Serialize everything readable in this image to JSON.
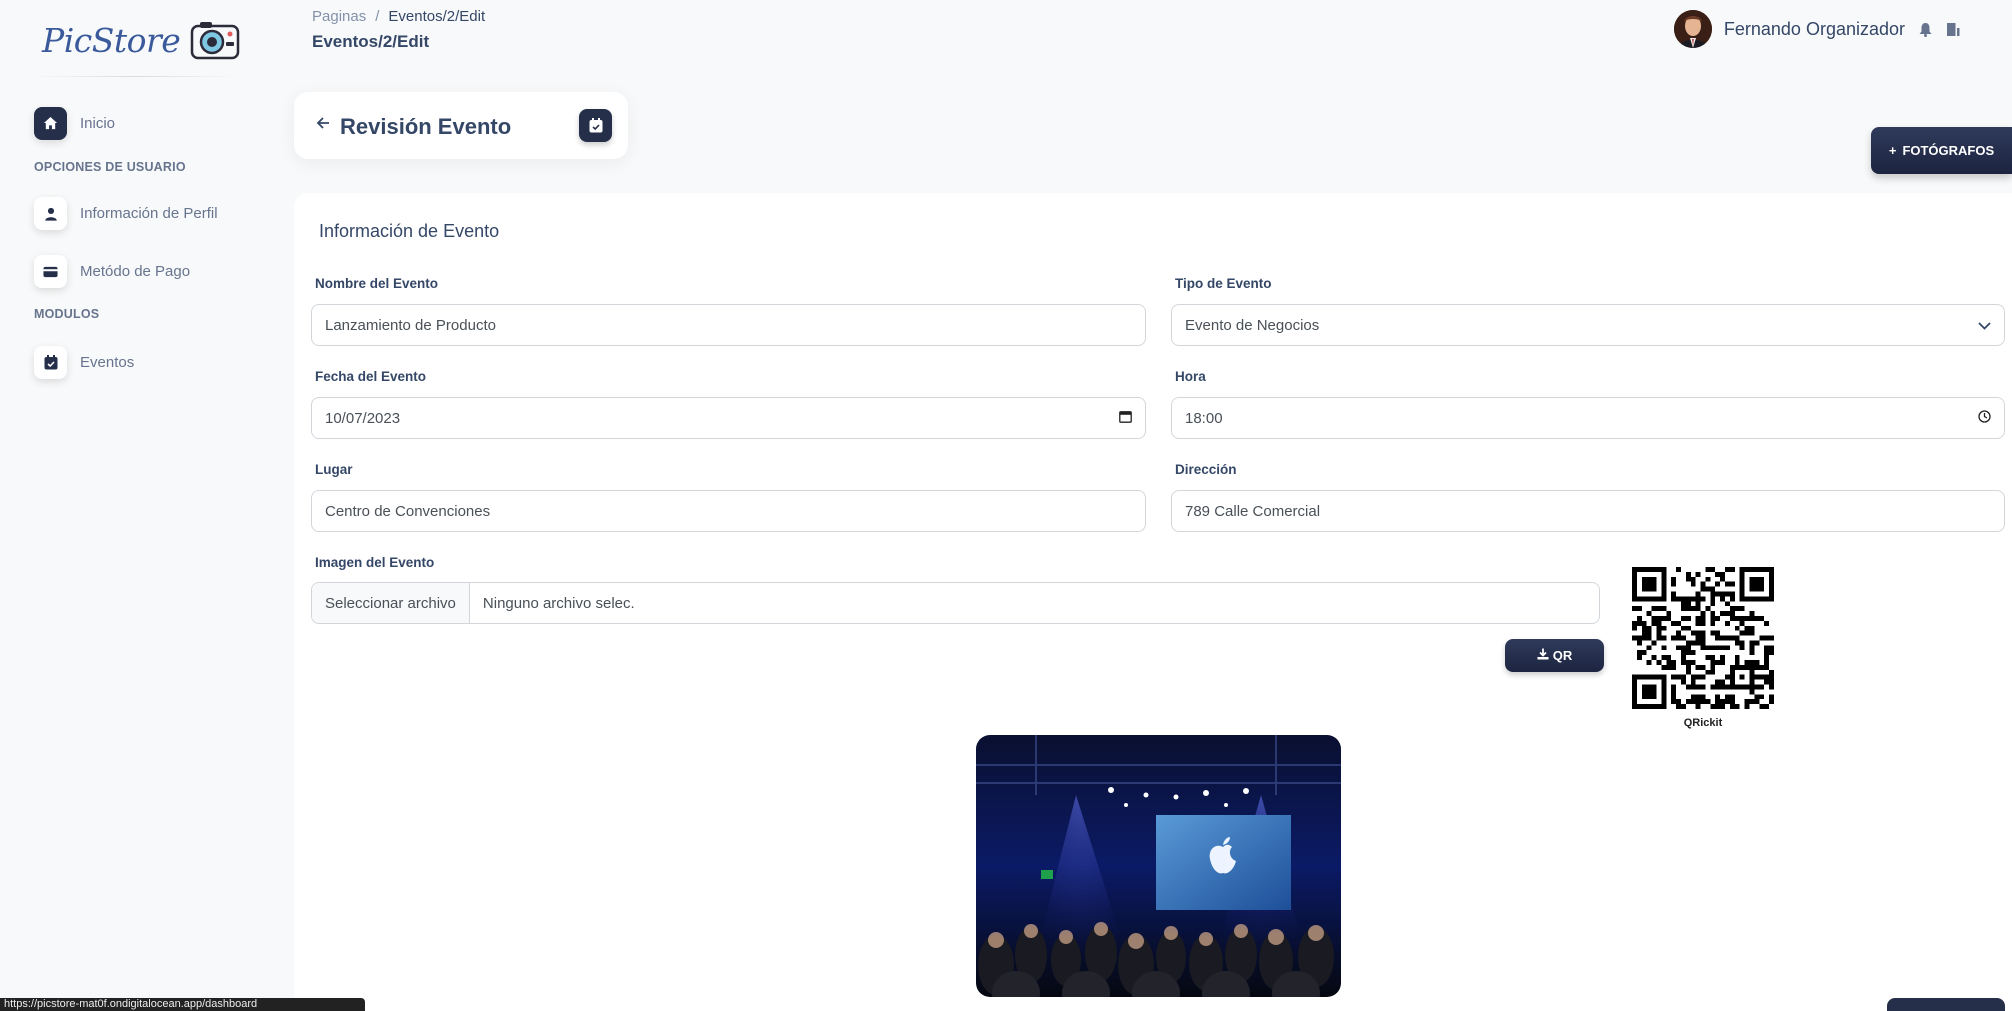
{
  "brand": {
    "name": "PicStore"
  },
  "sidebar": {
    "items": [
      {
        "label": "Inicio",
        "icon": "home-icon"
      },
      {
        "label": "Información de Perfil",
        "icon": "user-icon"
      },
      {
        "label": "Metódo de Pago",
        "icon": "credit-card-icon"
      },
      {
        "label": "Eventos",
        "icon": "calendar-check-icon"
      }
    ],
    "sections": [
      "OPCIONES DE USUARIO",
      "MODULOS"
    ]
  },
  "breadcrumb": {
    "root": "Paginas",
    "separator": "/",
    "current": "Eventos/2/Edit"
  },
  "header": {
    "title": "Eventos/2/Edit",
    "user_name": "Fernando Organizador"
  },
  "revision": {
    "title": "Revisión Evento"
  },
  "actions": {
    "photographers": "FOTÓGRAFOS",
    "qr": "QR"
  },
  "form": {
    "section_title": "Información de Evento",
    "name_label": "Nombre del Evento",
    "name_value": "Lanzamiento de Producto",
    "type_label": "Tipo de Evento",
    "type_value": "Evento de Negocios",
    "date_label": "Fecha del Evento",
    "date_value": "10/07/2023",
    "time_label": "Hora",
    "time_value": "18:00",
    "place_label": "Lugar",
    "place_value": "Centro de Convenciones",
    "address_label": "Dirección",
    "address_value": "789 Calle Comercial",
    "image_label": "Imagen del Evento",
    "file_button": "Seleccionar archivo",
    "file_name": "Ninguno archivo selec.",
    "qr_caption": "QRickit"
  },
  "status_bar": {
    "url": "https://picstore-mat0f.ondigitalocean.app/dashboard"
  },
  "colors": {
    "primary": "#252f4a",
    "text": "#344767",
    "muted": "#67748e",
    "background": "#f8f9fa"
  }
}
